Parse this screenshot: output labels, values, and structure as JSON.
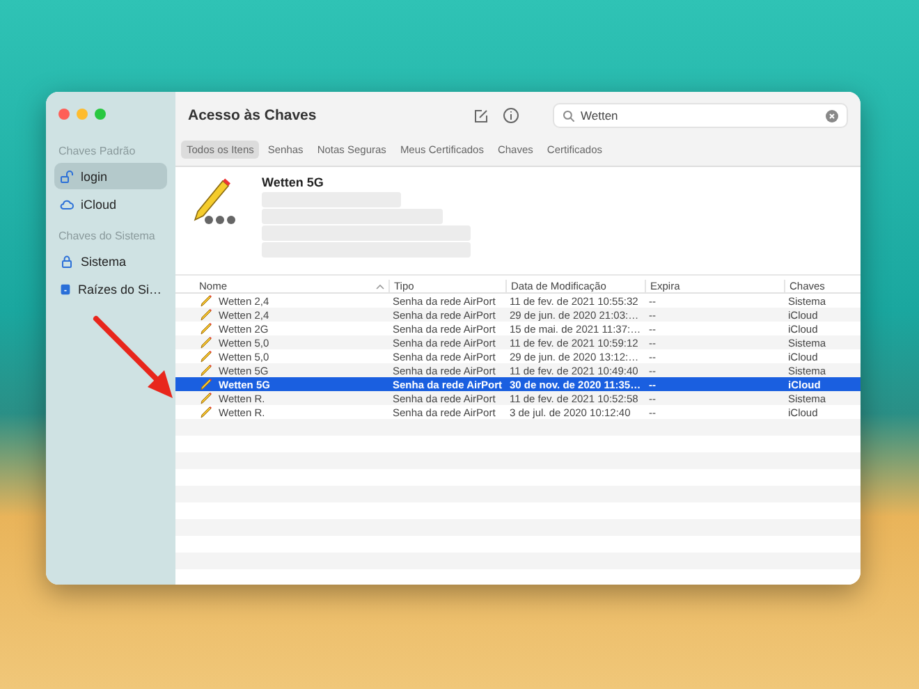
{
  "window": {
    "title": "Acesso às Chaves"
  },
  "search": {
    "value": "Wetten"
  },
  "sidebar": {
    "sections": [
      {
        "heading": "Chaves Padrão",
        "items": [
          {
            "label": "login",
            "selected": true
          },
          {
            "label": "iCloud",
            "selected": false
          }
        ]
      },
      {
        "heading": "Chaves do Sistema",
        "items": [
          {
            "label": "Sistema",
            "selected": false
          },
          {
            "label": "Raízes do Si…",
            "selected": false
          }
        ]
      }
    ]
  },
  "tabs": [
    {
      "label": "Todos os Itens",
      "selected": true
    },
    {
      "label": "Senhas",
      "selected": false
    },
    {
      "label": "Notas Seguras",
      "selected": false
    },
    {
      "label": "Meus Certificados",
      "selected": false
    },
    {
      "label": "Chaves",
      "selected": false
    },
    {
      "label": "Certificados",
      "selected": false
    }
  ],
  "detail": {
    "title": "Wetten 5G"
  },
  "table": {
    "columns": [
      "Nome",
      "Tipo",
      "Data de Modificação",
      "Expira",
      "Chaves"
    ],
    "rows": [
      {
        "cells": [
          "Wetten 2,4",
          "Senha da rede AirPort",
          "11 de fev. de 2021 10:55:32",
          "--",
          "Sistema"
        ],
        "selected": false
      },
      {
        "cells": [
          "Wetten 2,4",
          "Senha da rede AirPort",
          "29 de jun. de 2020 21:03:…",
          "--",
          "iCloud"
        ],
        "selected": false
      },
      {
        "cells": [
          "Wetten 2G",
          "Senha da rede AirPort",
          "15 de mai. de 2021 11:37:…",
          "--",
          "iCloud"
        ],
        "selected": false
      },
      {
        "cells": [
          "Wetten 5,0",
          "Senha da rede AirPort",
          "11 de fev. de 2021 10:59:12",
          "--",
          "Sistema"
        ],
        "selected": false
      },
      {
        "cells": [
          "Wetten 5,0",
          "Senha da rede AirPort",
          "29 de jun. de 2020 13:12:…",
          "--",
          "iCloud"
        ],
        "selected": false
      },
      {
        "cells": [
          "Wetten 5G",
          "Senha da rede AirPort",
          "11 de fev. de 2021 10:49:40",
          "--",
          "Sistema"
        ],
        "selected": false
      },
      {
        "cells": [
          "Wetten 5G",
          "Senha da rede AirPort",
          "30 de nov. de 2020 11:35…",
          "--",
          "iCloud"
        ],
        "selected": true
      },
      {
        "cells": [
          "Wetten R.",
          "Senha da rede AirPort",
          "11 de fev. de 2021 10:52:58",
          "--",
          "Sistema"
        ],
        "selected": false
      },
      {
        "cells": [
          "Wetten R.",
          "Senha da rede AirPort",
          "3 de jul. de 2020 10:12:40",
          "--",
          "iCloud"
        ],
        "selected": false
      }
    ]
  }
}
